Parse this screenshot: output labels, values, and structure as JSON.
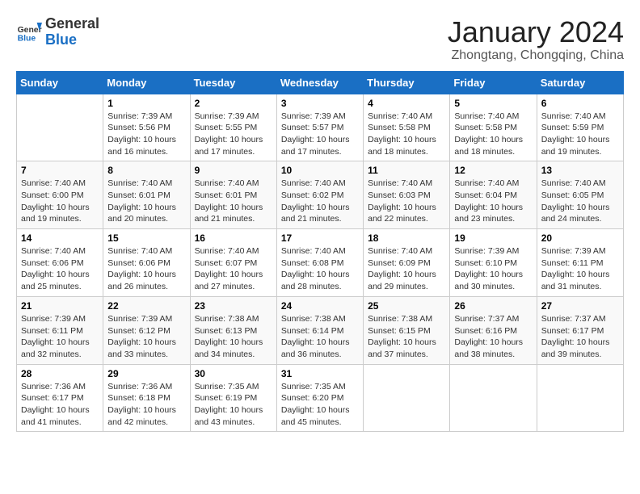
{
  "header": {
    "logo_general": "General",
    "logo_blue": "Blue",
    "title": "January 2024",
    "subtitle": "Zhongtang, Chongqing, China"
  },
  "weekdays": [
    "Sunday",
    "Monday",
    "Tuesday",
    "Wednesday",
    "Thursday",
    "Friday",
    "Saturday"
  ],
  "weeks": [
    [
      {
        "day": "",
        "info": ""
      },
      {
        "day": "1",
        "info": "Sunrise: 7:39 AM\nSunset: 5:56 PM\nDaylight: 10 hours\nand 16 minutes."
      },
      {
        "day": "2",
        "info": "Sunrise: 7:39 AM\nSunset: 5:55 PM\nDaylight: 10 hours\nand 17 minutes."
      },
      {
        "day": "3",
        "info": "Sunrise: 7:39 AM\nSunset: 5:57 PM\nDaylight: 10 hours\nand 17 minutes."
      },
      {
        "day": "4",
        "info": "Sunrise: 7:40 AM\nSunset: 5:58 PM\nDaylight: 10 hours\nand 18 minutes."
      },
      {
        "day": "5",
        "info": "Sunrise: 7:40 AM\nSunset: 5:58 PM\nDaylight: 10 hours\nand 18 minutes."
      },
      {
        "day": "6",
        "info": "Sunrise: 7:40 AM\nSunset: 5:59 PM\nDaylight: 10 hours\nand 19 minutes."
      }
    ],
    [
      {
        "day": "7",
        "info": "Sunrise: 7:40 AM\nSunset: 6:00 PM\nDaylight: 10 hours\nand 19 minutes."
      },
      {
        "day": "8",
        "info": "Sunrise: 7:40 AM\nSunset: 6:01 PM\nDaylight: 10 hours\nand 20 minutes."
      },
      {
        "day": "9",
        "info": "Sunrise: 7:40 AM\nSunset: 6:01 PM\nDaylight: 10 hours\nand 21 minutes."
      },
      {
        "day": "10",
        "info": "Sunrise: 7:40 AM\nSunset: 6:02 PM\nDaylight: 10 hours\nand 21 minutes."
      },
      {
        "day": "11",
        "info": "Sunrise: 7:40 AM\nSunset: 6:03 PM\nDaylight: 10 hours\nand 22 minutes."
      },
      {
        "day": "12",
        "info": "Sunrise: 7:40 AM\nSunset: 6:04 PM\nDaylight: 10 hours\nand 23 minutes."
      },
      {
        "day": "13",
        "info": "Sunrise: 7:40 AM\nSunset: 6:05 PM\nDaylight: 10 hours\nand 24 minutes."
      }
    ],
    [
      {
        "day": "14",
        "info": "Sunrise: 7:40 AM\nSunset: 6:06 PM\nDaylight: 10 hours\nand 25 minutes."
      },
      {
        "day": "15",
        "info": "Sunrise: 7:40 AM\nSunset: 6:06 PM\nDaylight: 10 hours\nand 26 minutes."
      },
      {
        "day": "16",
        "info": "Sunrise: 7:40 AM\nSunset: 6:07 PM\nDaylight: 10 hours\nand 27 minutes."
      },
      {
        "day": "17",
        "info": "Sunrise: 7:40 AM\nSunset: 6:08 PM\nDaylight: 10 hours\nand 28 minutes."
      },
      {
        "day": "18",
        "info": "Sunrise: 7:40 AM\nSunset: 6:09 PM\nDaylight: 10 hours\nand 29 minutes."
      },
      {
        "day": "19",
        "info": "Sunrise: 7:39 AM\nSunset: 6:10 PM\nDaylight: 10 hours\nand 30 minutes."
      },
      {
        "day": "20",
        "info": "Sunrise: 7:39 AM\nSunset: 6:11 PM\nDaylight: 10 hours\nand 31 minutes."
      }
    ],
    [
      {
        "day": "21",
        "info": "Sunrise: 7:39 AM\nSunset: 6:11 PM\nDaylight: 10 hours\nand 32 minutes."
      },
      {
        "day": "22",
        "info": "Sunrise: 7:39 AM\nSunset: 6:12 PM\nDaylight: 10 hours\nand 33 minutes."
      },
      {
        "day": "23",
        "info": "Sunrise: 7:38 AM\nSunset: 6:13 PM\nDaylight: 10 hours\nand 34 minutes."
      },
      {
        "day": "24",
        "info": "Sunrise: 7:38 AM\nSunset: 6:14 PM\nDaylight: 10 hours\nand 36 minutes."
      },
      {
        "day": "25",
        "info": "Sunrise: 7:38 AM\nSunset: 6:15 PM\nDaylight: 10 hours\nand 37 minutes."
      },
      {
        "day": "26",
        "info": "Sunrise: 7:37 AM\nSunset: 6:16 PM\nDaylight: 10 hours\nand 38 minutes."
      },
      {
        "day": "27",
        "info": "Sunrise: 7:37 AM\nSunset: 6:17 PM\nDaylight: 10 hours\nand 39 minutes."
      }
    ],
    [
      {
        "day": "28",
        "info": "Sunrise: 7:36 AM\nSunset: 6:17 PM\nDaylight: 10 hours\nand 41 minutes."
      },
      {
        "day": "29",
        "info": "Sunrise: 7:36 AM\nSunset: 6:18 PM\nDaylight: 10 hours\nand 42 minutes."
      },
      {
        "day": "30",
        "info": "Sunrise: 7:35 AM\nSunset: 6:19 PM\nDaylight: 10 hours\nand 43 minutes."
      },
      {
        "day": "31",
        "info": "Sunrise: 7:35 AM\nSunset: 6:20 PM\nDaylight: 10 hours\nand 45 minutes."
      },
      {
        "day": "",
        "info": ""
      },
      {
        "day": "",
        "info": ""
      },
      {
        "day": "",
        "info": ""
      }
    ]
  ]
}
